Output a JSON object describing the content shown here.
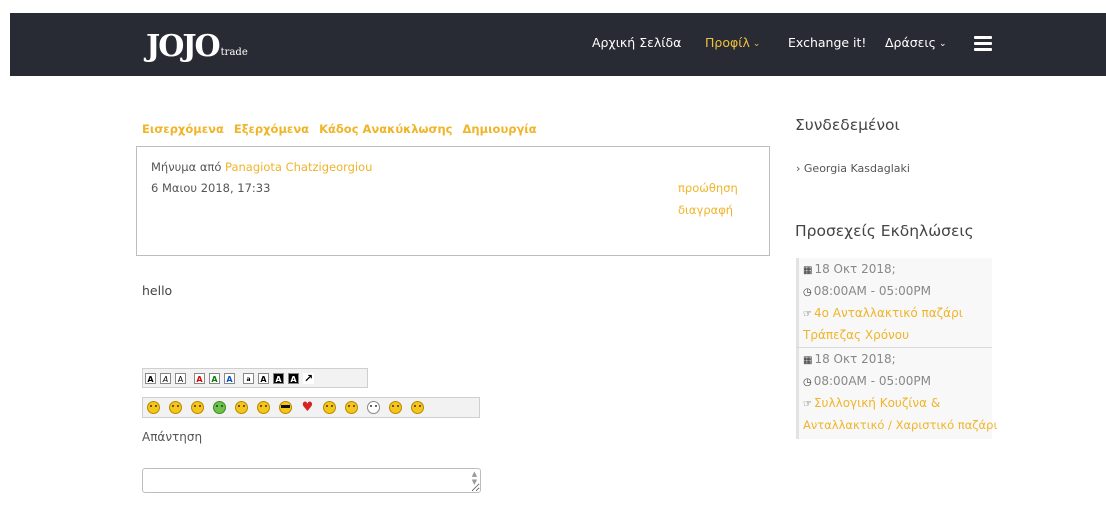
{
  "brand": {
    "logo_mark": "JOJO",
    "logo_sub": "trade"
  },
  "nav": {
    "home": "Αρχική Σελίδα",
    "profile": "Προφίλ",
    "exchange": "Exchange it!",
    "actions": "Δράσεις",
    "chevron": "⌄",
    "menu_icon": "hamburger-icon"
  },
  "tabs": [
    "Εισερχόμενα",
    "Εξερχόμενα",
    "Κάδος Ανακύκλωσης",
    "Δημιουργία"
  ],
  "message": {
    "from_prefix": "Μήνυμα από",
    "sender": "Panagiota Chatzigeorgiou",
    "date": "6 Μαιου 2018, 17:33",
    "forward": "προώθηση",
    "delete": "διαγραφή",
    "body": "hello"
  },
  "format_toolbar": {
    "buttons": [
      "A",
      "A",
      "A",
      "A",
      "A",
      "A",
      "a",
      "A",
      "A",
      "A",
      "↗"
    ]
  },
  "emoji_toolbar": {
    "icons": [
      "smile-emoji",
      "tongue-emoji",
      "grin-emoji",
      "sick-emoji",
      "wave-emoji",
      "thinking-emoji",
      "cool-emoji",
      "heart-emoji",
      "kiss-emoji",
      "think-emoji",
      "sad-emoji",
      "wink-emoji",
      "eyes-emoji"
    ]
  },
  "reply": {
    "label": "Απάντηση",
    "value": "",
    "placeholder": ""
  },
  "sidebar": {
    "online_title": "Συνδεδεμένοι",
    "online_users": [
      "Georgia Kasdaglaki"
    ],
    "events_title": "Προσεχείς Εκδηλώσεις",
    "events": [
      {
        "date": "18 Οκτ 2018;",
        "time": "08:00AM - 05:00PM",
        "title_line1": "4ο Ανταλλακτικό παζάρι",
        "title_line2": "Τράπεζας Χρόνου"
      },
      {
        "date": "18 Οκτ 2018;",
        "time": "08:00AM - 05:00PM",
        "title_line1": "Συλλογική Κουζίνα &",
        "title_line2": "Ανταλλακτικό / Χαριστικό παζάρι"
      }
    ]
  },
  "colors": {
    "accent": "#f0b429",
    "header_bg": "#282b33"
  }
}
